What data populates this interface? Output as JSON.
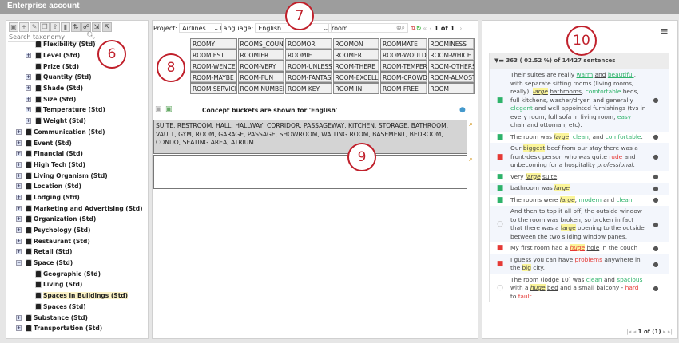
{
  "title": "Enterprise account",
  "left": {
    "toolbar_icons": [
      "save-icon",
      "add-icon",
      "edit-icon",
      "copy-icon",
      "export-icon",
      "delete-icon",
      "refresh-icon",
      "hierarchy-icon",
      "import-icon",
      "export-all-icon"
    ],
    "search_placeholder": "Search taxonomy",
    "tree": [
      {
        "label": "Flexibility (Std)",
        "level": 2,
        "exp": ""
      },
      {
        "label": "Level (Std)",
        "level": 1,
        "exp": "+"
      },
      {
        "label": "Prize (Std)",
        "level": 2,
        "exp": ""
      },
      {
        "label": "Quantity (Std)",
        "level": 1,
        "exp": "+"
      },
      {
        "label": "Shade (Std)",
        "level": 1,
        "exp": "+"
      },
      {
        "label": "Size (Std)",
        "level": 1,
        "exp": "+"
      },
      {
        "label": "Temperature (Std)",
        "level": 1,
        "exp": "+"
      },
      {
        "label": "Weight (Std)",
        "level": 1,
        "exp": "+"
      },
      {
        "label": "Communication (Std)",
        "level": 0,
        "exp": "+"
      },
      {
        "label": "Event (Std)",
        "level": 0,
        "exp": "+"
      },
      {
        "label": "Financial (Std)",
        "level": 0,
        "exp": "+"
      },
      {
        "label": "High Tech (Std)",
        "level": 0,
        "exp": "+"
      },
      {
        "label": "Living Organism (Std)",
        "level": 0,
        "exp": "+"
      },
      {
        "label": "Location (Std)",
        "level": 0,
        "exp": "+"
      },
      {
        "label": "Lodging (Std)",
        "level": 0,
        "exp": "+"
      },
      {
        "label": "Marketing and Advertising (Std)",
        "level": 0,
        "exp": "+"
      },
      {
        "label": "Organization (Std)",
        "level": 0,
        "exp": "+"
      },
      {
        "label": "Psychology (Std)",
        "level": 0,
        "exp": "+"
      },
      {
        "label": "Restaurant (Std)",
        "level": 0,
        "exp": "+"
      },
      {
        "label": "Retail (Std)",
        "level": 0,
        "exp": "+"
      },
      {
        "label": "Space (Std)",
        "level": 0,
        "exp": "-"
      },
      {
        "label": "Geographic (Std)",
        "level": 1.5,
        "exp": ""
      },
      {
        "label": "Living (Std)",
        "level": 1.5,
        "exp": ""
      },
      {
        "label": "Spaces in Buildings (Std)",
        "level": 1.5,
        "exp": "",
        "selected": true
      },
      {
        "label": "Spaces (Std)",
        "level": 1.5,
        "exp": ""
      },
      {
        "label": "Substance (Std)",
        "level": 0,
        "exp": "+"
      },
      {
        "label": "Transportation (Std)",
        "level": 0,
        "exp": "+"
      }
    ]
  },
  "mid": {
    "project_label": "Project:",
    "project_value": "Airlines",
    "language_label": "Language:",
    "language_value": "English",
    "search_value": "room",
    "page": "1 of 1",
    "words": [
      "ROOMY",
      "ROOMS_COUNT",
      "ROOMOR",
      "ROOMON",
      "ROOMMATE",
      "ROOMINESS",
      "ROOMIEST",
      "ROOMIER",
      "ROOMIE",
      "ROOMER",
      "ROOM-WOULD",
      "ROOM-WHICH",
      "ROOM-WENCE",
      "ROOM-VERY",
      "ROOM-UNLESS",
      "ROOM-THERE",
      "ROOM-TEMPER...",
      "ROOM-OTHERS",
      "ROOM-MAYBE",
      "ROOM-FUN",
      "ROOM-FANTAS...",
      "ROOM-EXCELL...",
      "ROOM-CROWDED",
      "ROOM-ALMOST",
      "ROOM SERVICE",
      "ROOM NUMBER",
      "ROOM KEY",
      "ROOM IN",
      "ROOM FREE",
      "ROOM"
    ],
    "bucket_note": "Concept buckets are shown for 'English'",
    "bucket_text": "SUITE, RESTROOM, HALL, HALLWAY, CORRIDOR, PASSAGEWAY, KITCHEN, STORAGE, BATHROOM, VAULT, GYM, ROOM, GARAGE, PASSAGE, SHOWROOM, WAITING ROOM, BASEMENT, BEDROOM, CONDO, SEATING AREA, ATRIUM",
    "second_text": ""
  },
  "right": {
    "header": "363 ( 02.52 %) of 14427 sentences",
    "pagination": "1 of (1)",
    "sentences": [
      {
        "sentiment": "positive",
        "parts": [
          [
            "Their suites are really ",
            ""
          ],
          [
            "warm",
            "pos u"
          ],
          [
            " ",
            ""
          ],
          [
            "and",
            "u"
          ],
          [
            " ",
            ""
          ],
          [
            "beautiful",
            "pos u"
          ],
          [
            ", with separate sitting rooms (living rooms, really), ",
            ""
          ],
          [
            "large",
            "hl i u"
          ],
          [
            " ",
            ""
          ],
          [
            "bathrooms",
            "u"
          ],
          [
            ", ",
            ""
          ],
          [
            "comfortable",
            "pos"
          ],
          [
            " beds, full kitchens, washer/dryer, and generally ",
            ""
          ],
          [
            "elegant",
            "pos"
          ],
          [
            " and well appointed furnishings (tvs in every room, full sofa in living room, ",
            ""
          ],
          [
            "easy",
            "pos"
          ],
          [
            " chair and ottoman, etc).",
            ""
          ]
        ]
      },
      {
        "sentiment": "positive",
        "parts": [
          [
            "The ",
            ""
          ],
          [
            "room",
            "u"
          ],
          [
            " was ",
            ""
          ],
          [
            "large",
            "hl i u"
          ],
          [
            ", ",
            ""
          ],
          [
            "clean",
            "pos"
          ],
          [
            ", and ",
            ""
          ],
          [
            "comfortable",
            "pos"
          ],
          [
            ".",
            ""
          ]
        ]
      },
      {
        "sentiment": "negative",
        "parts": [
          [
            "Our ",
            ""
          ],
          [
            "biggest",
            "hl"
          ],
          [
            " beef from our stay there was a front-desk person who was quite ",
            ""
          ],
          [
            "rude",
            "neg u"
          ],
          [
            " and unbecoming for a hospitality ",
            ""
          ],
          [
            "professional",
            "i u"
          ],
          [
            ".",
            ""
          ]
        ]
      },
      {
        "sentiment": "positive",
        "parts": [
          [
            "Very ",
            ""
          ],
          [
            "large",
            "hl i u"
          ],
          [
            " ",
            ""
          ],
          [
            "suite",
            "u"
          ],
          [
            ".",
            ""
          ]
        ]
      },
      {
        "sentiment": "positive",
        "parts": [
          [
            "bathroom",
            "u"
          ],
          [
            " was ",
            ""
          ],
          [
            "large",
            "hl i"
          ]
        ]
      },
      {
        "sentiment": "positive",
        "parts": [
          [
            "The ",
            ""
          ],
          [
            "rooms",
            "u"
          ],
          [
            " were ",
            ""
          ],
          [
            "large",
            "hl i u"
          ],
          [
            ", ",
            ""
          ],
          [
            "modern",
            "pos"
          ],
          [
            " and ",
            ""
          ],
          [
            "clean",
            "pos"
          ]
        ]
      },
      {
        "sentiment": "neutral",
        "parts": [
          [
            "And then to top it all off, the outside window to the room was broken, so broken in fact that there was a ",
            ""
          ],
          [
            "large",
            "hl"
          ],
          [
            " opening to the outside between the two sliding window panes.",
            ""
          ]
        ]
      },
      {
        "sentiment": "negative",
        "parts": [
          [
            "My first room had a ",
            ""
          ],
          [
            "huge",
            "hl i neg u"
          ],
          [
            " ",
            ""
          ],
          [
            "hole",
            "u"
          ],
          [
            " in the couch",
            ""
          ]
        ]
      },
      {
        "sentiment": "negative",
        "parts": [
          [
            "I guess you can have ",
            ""
          ],
          [
            "problems",
            "neg"
          ],
          [
            " anywhere in the ",
            ""
          ],
          [
            "big",
            "hl"
          ],
          [
            " city.",
            ""
          ]
        ]
      },
      {
        "sentiment": "neutral",
        "parts": [
          [
            "The room (lodge 10) was ",
            ""
          ],
          [
            "clean",
            "pos"
          ],
          [
            " and ",
            ""
          ],
          [
            "spacious",
            "pos"
          ],
          [
            " with a ",
            ""
          ],
          [
            "huge",
            "hl i u"
          ],
          [
            " ",
            ""
          ],
          [
            "bed",
            "u"
          ],
          [
            " and a small balcony - ",
            ""
          ],
          [
            "hard",
            "neg"
          ],
          [
            " to ",
            ""
          ],
          [
            "fault",
            "neg"
          ],
          [
            ".",
            ""
          ]
        ]
      }
    ]
  },
  "callouts": [
    "6",
    "7",
    "8",
    "9",
    "10"
  ],
  "colors": {
    "positive": "#2eb36a",
    "negative": "#e53935",
    "highlight": "#fbf59a",
    "callout": "#c0202b",
    "titlebar": "#9d9d9d"
  }
}
